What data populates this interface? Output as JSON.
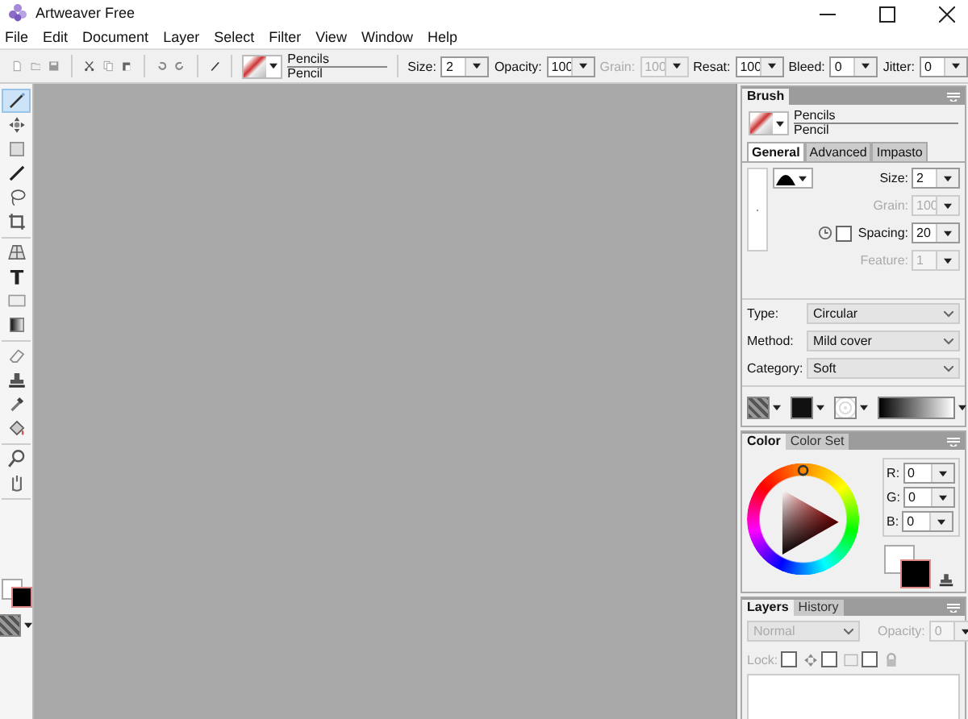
{
  "window": {
    "title": "Artweaver Free"
  },
  "menu": [
    "File",
    "Edit",
    "Document",
    "Layer",
    "Select",
    "Filter",
    "View",
    "Window",
    "Help"
  ],
  "toolbar": {
    "brush_set": "Pencils",
    "brush": "Pencil",
    "fields": [
      {
        "label": "Size:",
        "value": "2",
        "disabled": false
      },
      {
        "label": "Opacity:",
        "value": "100",
        "disabled": false
      },
      {
        "label": "Grain:",
        "value": "100",
        "disabled": true
      },
      {
        "label": "Resat:",
        "value": "100",
        "disabled": false
      },
      {
        "label": "Bleed:",
        "value": "0",
        "disabled": false
      },
      {
        "label": "Jitter:",
        "value": "0",
        "disabled": false
      }
    ]
  },
  "tools": [
    {
      "kind": "brush",
      "selected": true
    },
    {
      "kind": "move",
      "selected": false
    },
    {
      "kind": "rect",
      "selected": false
    },
    {
      "kind": "line",
      "selected": false
    },
    {
      "kind": "lasso",
      "selected": false
    },
    {
      "kind": "crop",
      "selected": false
    },
    {
      "kind": "perspective",
      "selected": false
    },
    {
      "kind": "text",
      "selected": false
    },
    {
      "kind": "shape",
      "selected": false
    },
    {
      "kind": "gradient",
      "selected": false
    },
    {
      "kind": "eraser",
      "selected": false
    },
    {
      "kind": "stamp",
      "selected": false
    },
    {
      "kind": "dropper",
      "selected": false
    },
    {
      "kind": "fill",
      "selected": false
    },
    {
      "kind": "zoom",
      "selected": false
    },
    {
      "kind": "hand",
      "selected": false
    }
  ],
  "brush_panel": {
    "title": "Brush",
    "brush_set": "Pencils",
    "brush": "Pencil",
    "tabs": [
      {
        "label": "General",
        "selected": true
      },
      {
        "label": "Advanced",
        "selected": false
      },
      {
        "label": "Impasto",
        "selected": false
      }
    ],
    "fields": [
      {
        "label": "Size:",
        "value": "2",
        "disabled": false
      },
      {
        "label": "Grain:",
        "value": "100",
        "disabled": true
      },
      {
        "label": "Spacing:",
        "value": "20",
        "disabled": false,
        "checked": false
      },
      {
        "label": "Feature:",
        "value": "1",
        "disabled": true
      }
    ],
    "selects": [
      {
        "label": "Type:",
        "value": "Circular"
      },
      {
        "label": "Method:",
        "value": "Mild cover"
      },
      {
        "label": "Category:",
        "value": "Soft"
      }
    ]
  },
  "color_panel": {
    "tabs": [
      {
        "label": "Color",
        "selected": true
      },
      {
        "label": "Color Set",
        "selected": false
      }
    ],
    "channels": [
      {
        "label": "R:",
        "value": "0"
      },
      {
        "label": "G:",
        "value": "0"
      },
      {
        "label": "B:",
        "value": "0"
      }
    ]
  },
  "layers_panel": {
    "tabs": [
      {
        "label": "Layers",
        "selected": true
      },
      {
        "label": "History",
        "selected": false
      }
    ],
    "blend_mode": {
      "value": "Normal",
      "disabled": true
    },
    "opacity": {
      "label": "Opacity:",
      "value": "0",
      "disabled": true
    },
    "lock_label": "Lock:",
    "locks": [
      {
        "kind": "position",
        "checked": false
      },
      {
        "kind": "pixels",
        "checked": false
      },
      {
        "kind": "transparency",
        "checked": false
      }
    ]
  }
}
